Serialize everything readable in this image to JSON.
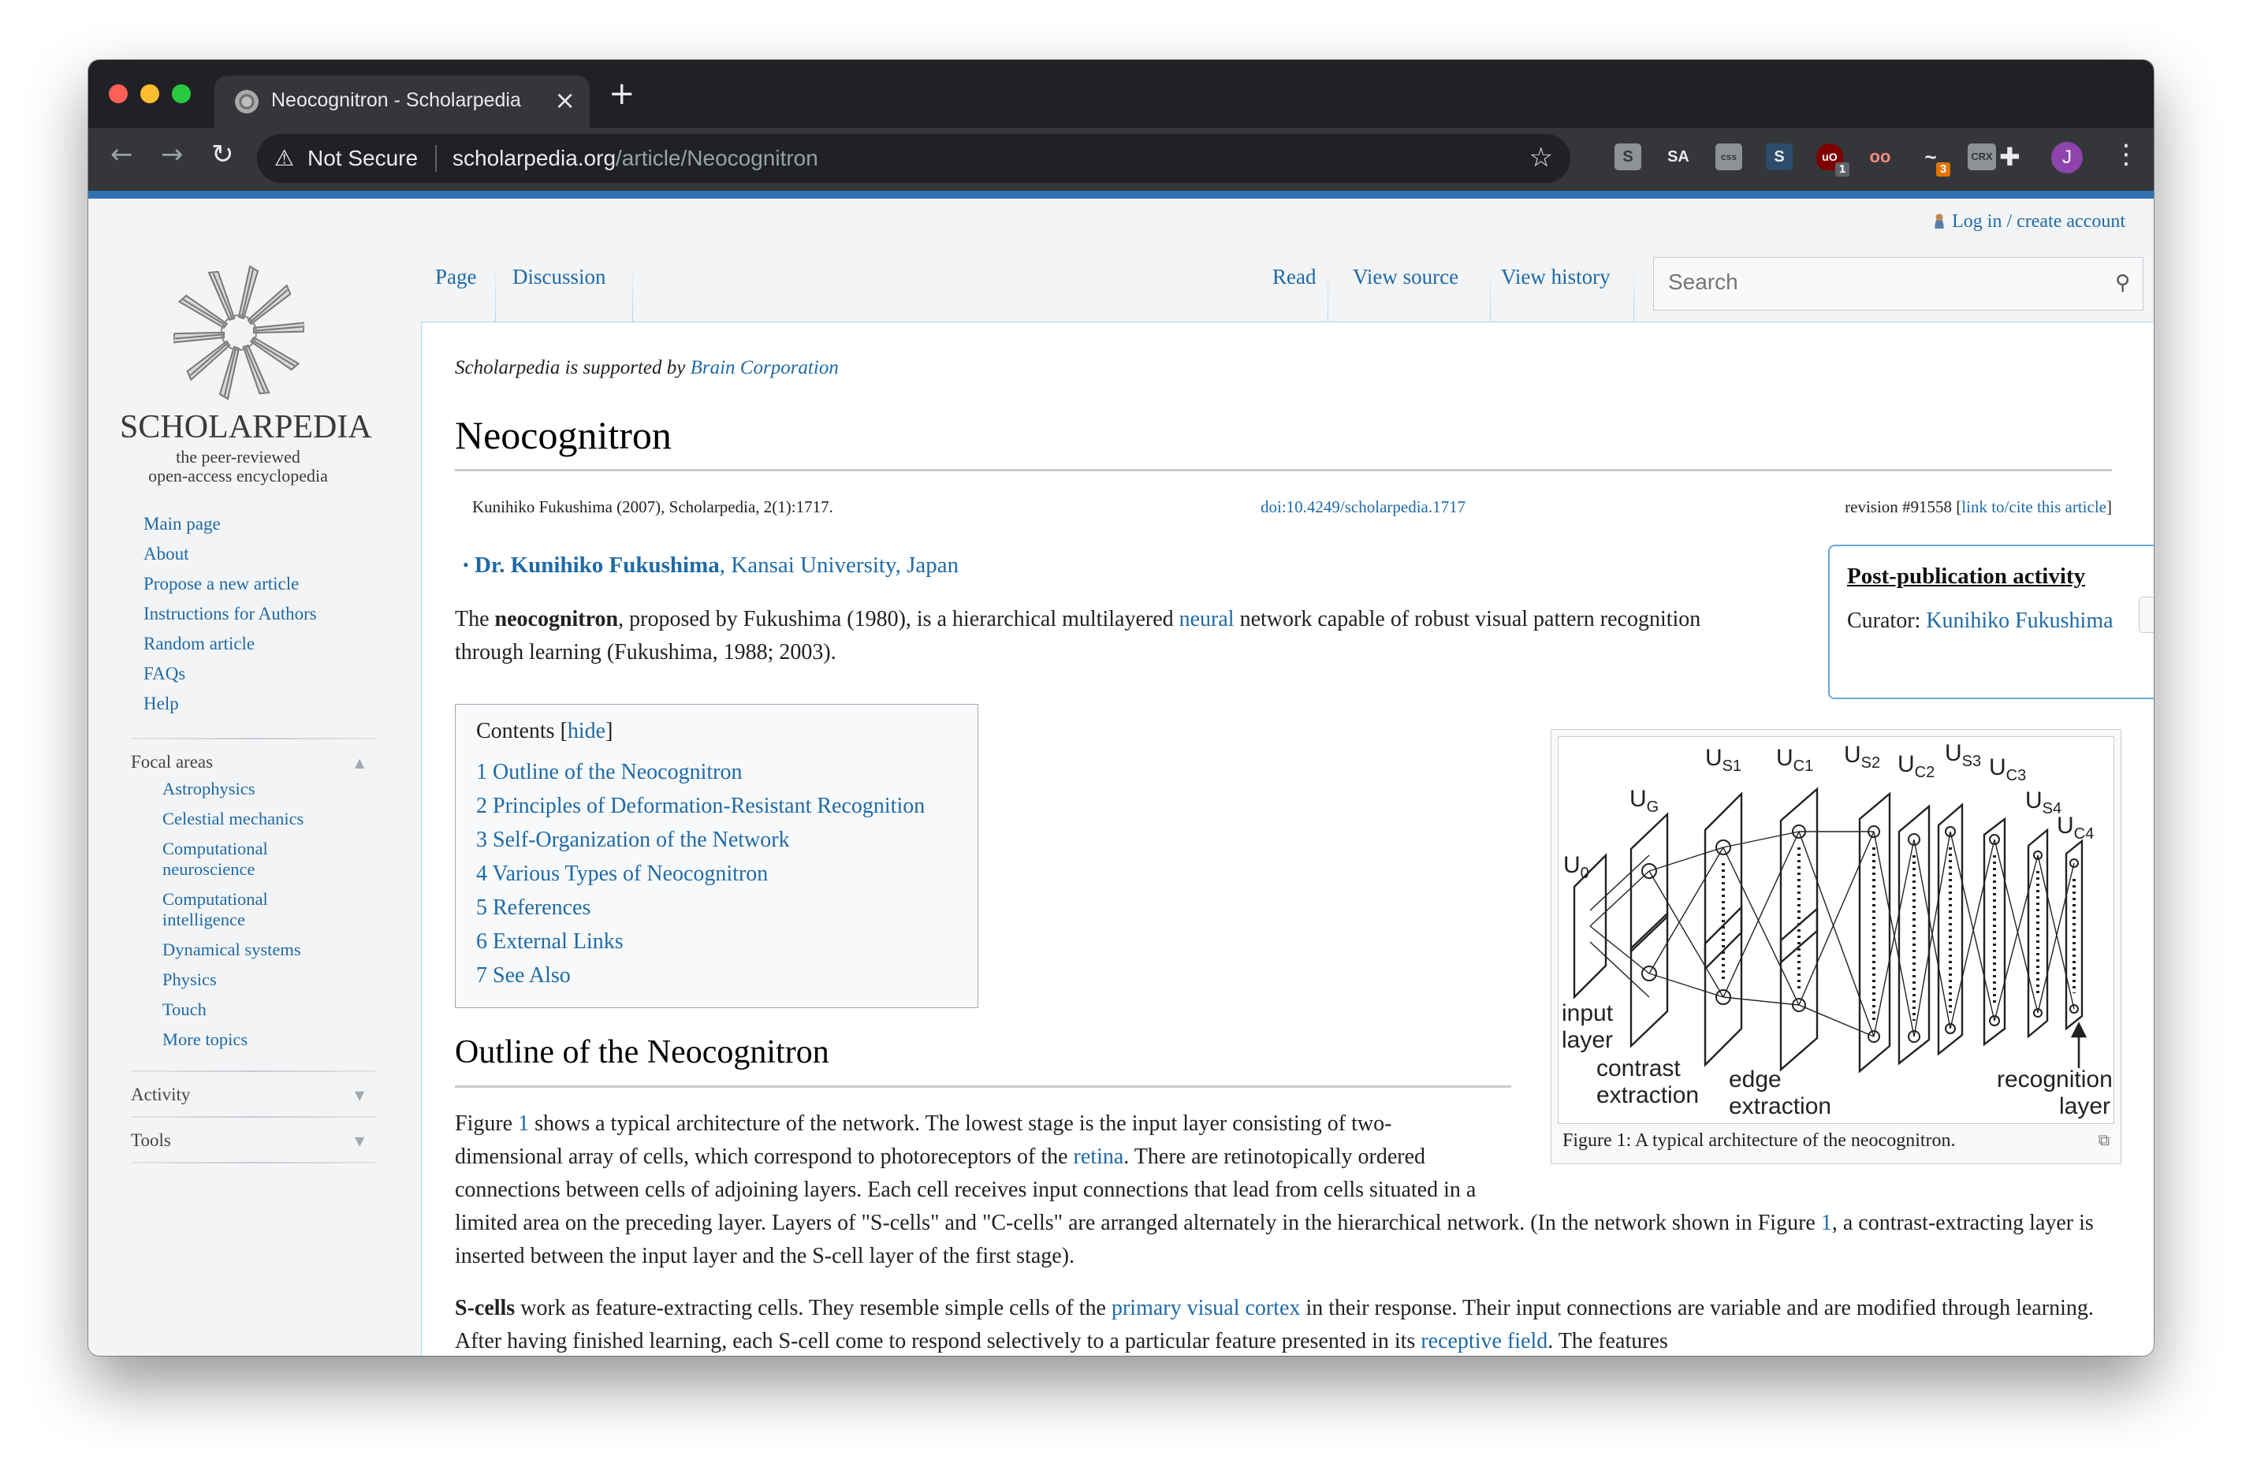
{
  "browser": {
    "tab_title": "Neocognitron - Scholarpedia",
    "security_label": "Not Secure",
    "url_host": "scholarpedia.org",
    "url_path": "/article/Neocognitron",
    "extensions": [
      {
        "name": "s-square",
        "glyph": "S",
        "badge": ""
      },
      {
        "name": "sa",
        "glyph": "SA",
        "badge": ""
      },
      {
        "name": "css-viewer",
        "glyph": "css",
        "badge": ""
      },
      {
        "name": "s-blue",
        "glyph": "S",
        "badge": ""
      },
      {
        "name": "ublock",
        "glyph": "uO",
        "badge": "1"
      },
      {
        "name": "glasses",
        "glyph": "oo",
        "badge": ""
      },
      {
        "name": "sloth",
        "glyph": "~",
        "badge": "3"
      },
      {
        "name": "crx",
        "glyph": "CRX",
        "badge": ""
      }
    ],
    "profile_initial": "J",
    "colors": {
      "frame": "#202124",
      "toolbar": "#35363a",
      "accent_bar": "#2f72b1"
    }
  },
  "page": {
    "login_link": "Log in / create account",
    "logo": {
      "wordmark": "SCHOLARPEDIA",
      "tagline_1": "the peer-reviewed",
      "tagline_2": "open-access encyclopedia"
    },
    "nav": [
      "Main page",
      "About",
      "Propose a new article",
      "Instructions for Authors",
      "Random article",
      "FAQs",
      "Help"
    ],
    "focal_areas": {
      "heading": "Focal areas",
      "items": [
        "Astrophysics",
        "Celestial mechanics",
        "Computational neuroscience",
        "Computational intelligence",
        "Dynamical systems",
        "Physics",
        "Touch",
        "More topics"
      ]
    },
    "activity_heading": "Activity",
    "tools_heading": "Tools",
    "tabs": {
      "page": "Page",
      "discussion": "Discussion",
      "read": "Read",
      "view_source": "View source",
      "view_history": "View history"
    },
    "search_placeholder": "Search",
    "sitenotice": {
      "prefix": "Scholarpedia is supported by ",
      "link": "Brain Corporation"
    },
    "title": "Neocognitron",
    "citation": {
      "text": "Kunihiko Fukushima (2007), Scholarpedia, 2(1):1717.",
      "doi": "doi:10.4249/scholarpedia.1717",
      "revision": "revision #91558 [",
      "cite_link": "link to/cite this article",
      "close": "]"
    },
    "author": {
      "bullet": "•",
      "name": "Dr. Kunihiko Fukushima",
      "affiliation": ", Kansai University, Japan"
    },
    "intro": {
      "t1": "The ",
      "b1": "neocognitron",
      "t2": ", proposed by Fukushima (1980), is a hierarchical multilayered ",
      "l1": "neural",
      "t3": " network capable of robust visual pattern recognition through learning (Fukushima, 1988; 2003)."
    },
    "post_pub": {
      "title": "Post-publication activity",
      "curator_label": "Curator: ",
      "curator_name": "Kunihiko Fukushima"
    },
    "toc": {
      "title": "Contents",
      "hide_open": " [",
      "hide": "hide",
      "hide_close": "]",
      "items": [
        "1 Outline of the Neocognitron",
        "2 Principles of Deformation-Resistant Recognition",
        "3 Self-Organization of the Network",
        "4 Various Types of Neocognitron",
        "5 References",
        "6 External Links",
        "7 See Also"
      ]
    },
    "figure": {
      "caption": "Figure 1: A typical architecture of the neocognitron.",
      "labels": {
        "u0": "U",
        "u0_sub": "0",
        "ug": "U",
        "ug_sub": "G",
        "us1": "U",
        "us1_sub": "S1",
        "uc1": "U",
        "uc1_sub": "C1",
        "us2": "U",
        "us2_sub": "S2",
        "uc2": "U",
        "uc2_sub": "C2",
        "us3": "U",
        "us3_sub": "S3",
        "uc3": "U",
        "uc3_sub": "C3",
        "us4": "U",
        "us4_sub": "S4",
        "uc4": "U",
        "uc4_sub": "C4",
        "input_1": "input",
        "input_2": "layer",
        "contrast_1": "contrast",
        "contrast_2": "extraction",
        "edge_1": "edge",
        "edge_2": "extraction",
        "recog_1": "recognition",
        "recog_2": "layer"
      }
    },
    "section1": {
      "title": "Outline of the Neocognitron",
      "p1": {
        "t1": "Figure ",
        "l1": "1",
        "t2": " shows a typical architecture of the network. The lowest stage is the input layer consisting of two-dimensional array of cells, which correspond to photoreceptors of the ",
        "l2": "retina",
        "t3": ". There are retinotopically ordered connections between cells of adjoining layers. Each cell receives input connections that lead from cells situated in a limited area on the preceding layer. Layers of \"S-cells\" and \"C-cells\" are arranged alternately in the hierarchical network. (In the network shown in Figure ",
        "l3": "1",
        "t4": ", a contrast-extracting layer is inserted between the input layer and the S-cell layer of the first stage)."
      },
      "p2": {
        "b1": "S-cells",
        "t1": " work as feature-extracting cells. They resemble simple cells of the ",
        "l1": "primary visual cortex",
        "t2": " in their response. Their input connections are variable and are modified through learning. After having finished learning, each S-cell come to respond selectively to a particular feature presented in its ",
        "l2": "receptive field",
        "t3": ". The features"
      }
    }
  }
}
